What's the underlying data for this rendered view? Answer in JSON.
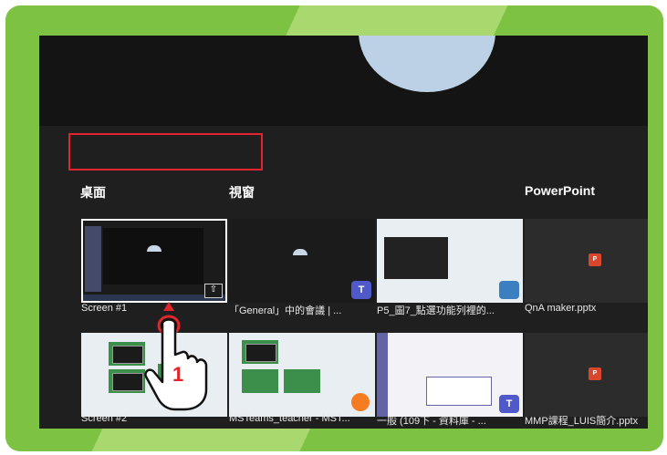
{
  "sections": {
    "desktop": "桌面",
    "window": "視窗",
    "powerpoint": "PowerPoint"
  },
  "tiles": {
    "row1": [
      {
        "caption": "Screen #1",
        "icon": "screen-icon"
      },
      {
        "caption": "「General」中的會議 | ...",
        "icon": "teams-icon"
      },
      {
        "caption": "P5_圖7_點選功能列裡的...",
        "icon": "paint-icon"
      },
      {
        "caption": "QnA maker.pptx",
        "icon": "powerpoint-icon"
      }
    ],
    "row2": [
      {
        "caption": "Screen #2",
        "icon": "screen-icon"
      },
      {
        "caption": "MSTeams_teacher - MST...",
        "icon": "firefox-icon"
      },
      {
        "caption": "一般 (109下 - 資料庫 - ...",
        "icon": "teams-icon"
      },
      {
        "caption": "MMP課程_LUIS簡介.pptx",
        "icon": "powerpoint-icon"
      }
    ]
  },
  "annotation": {
    "step_number": "1",
    "pointer_icon": "hand-pointer-icon",
    "highlight_color": "#e0262c"
  },
  "colors": {
    "frame_green": "#7dc242",
    "screen_bg": "#1f1f1f"
  }
}
